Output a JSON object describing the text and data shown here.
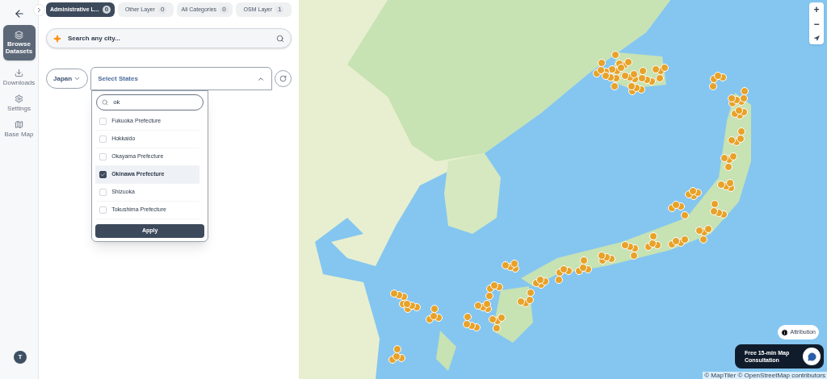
{
  "sidebar": {
    "items": [
      {
        "kind": "datasets",
        "label": "Browse Datasets",
        "selected": true
      },
      {
        "kind": "downloads",
        "label": "Downloads",
        "selected": false
      },
      {
        "kind": "settings",
        "label": "Settings",
        "selected": false
      },
      {
        "kind": "basemap",
        "label": "Base Map",
        "selected": false
      }
    ],
    "avatar": "T"
  },
  "layer_tabs": [
    {
      "label": "Administrative L...",
      "count": "0",
      "selected": true
    },
    {
      "label": "Other Layer",
      "count": "0",
      "selected": false
    },
    {
      "label": "All Categories",
      "count": "0",
      "selected": false
    },
    {
      "label": "OSM Layer",
      "count": "1",
      "selected": false
    }
  ],
  "search": {
    "placeholder": "Search any city..."
  },
  "country_select": {
    "value": "Japan"
  },
  "state_select": {
    "placeholder": "Select States",
    "expanded": true,
    "search_value": "ok",
    "options": [
      {
        "label": "Fukuoka Prefecture",
        "checked": false
      },
      {
        "label": "Hokkaido",
        "checked": false
      },
      {
        "label": "Okayama Prefecture",
        "checked": false
      },
      {
        "label": "Okinawa Prefecture",
        "checked": true
      },
      {
        "label": "Shizuoka",
        "checked": false
      },
      {
        "label": "Tokushima Prefecture",
        "checked": false
      }
    ],
    "apply": "Apply"
  },
  "map": {
    "zoom_in": "+",
    "zoom_out": "−",
    "attribution": "Attribution",
    "consultation": "Free 15-min Map Consultation",
    "copyright": "© MapTiler © OpenStreetMap contributors"
  }
}
